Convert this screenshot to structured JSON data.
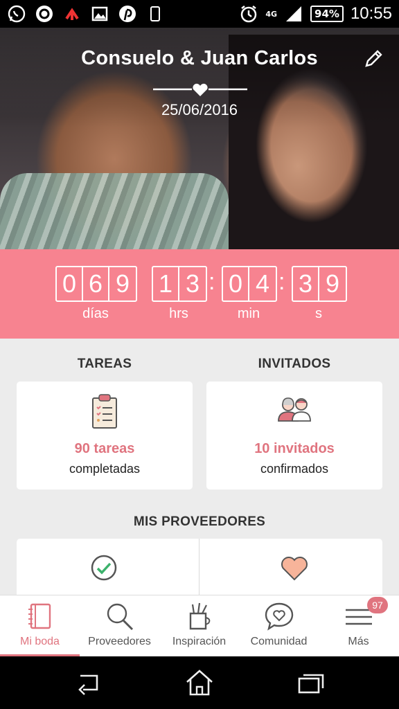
{
  "status_bar": {
    "network": "4G",
    "battery": "94%",
    "time": "10:55",
    "icons": [
      "whatsapp-icon",
      "browser-icon",
      "upload-icon",
      "image-icon",
      "pinterest-icon",
      "phone-icon",
      "alarm-icon",
      "signal-icon"
    ]
  },
  "header": {
    "couple_names": "Consuelo & Juan Carlos",
    "wedding_date": "25/06/2016",
    "edit_icon": "pencil-icon"
  },
  "countdown": {
    "days": [
      "0",
      "6",
      "9"
    ],
    "hours": [
      "1",
      "3"
    ],
    "minutes": [
      "0",
      "4"
    ],
    "seconds": [
      "3",
      "9"
    ],
    "separator": ":",
    "labels": {
      "days": "días",
      "hours": "hrs",
      "minutes": "min",
      "seconds": "s"
    }
  },
  "tasks": {
    "title": "TAREAS",
    "count": "90 tareas",
    "sub": "completadas",
    "icon": "clipboard-icon"
  },
  "guests": {
    "title": "INVITADOS",
    "count": "10 invitados",
    "sub": "confirmados",
    "icon": "guests-icon"
  },
  "vendors": {
    "title": "MIS PROVEEDORES",
    "items": [
      {
        "icon": "check-circle-icon"
      },
      {
        "icon": "heart-icon"
      }
    ]
  },
  "bottom_nav": {
    "items": [
      {
        "label": "Mi boda",
        "icon": "notebook-icon",
        "active": true
      },
      {
        "label": "Proveedores",
        "icon": "search-icon",
        "active": false
      },
      {
        "label": "Inspiración",
        "icon": "pencil-cup-icon",
        "active": false
      },
      {
        "label": "Comunidad",
        "icon": "chat-heart-icon",
        "active": false
      },
      {
        "label": "Más",
        "icon": "menu-icon",
        "active": false
      }
    ],
    "badge": "97"
  },
  "colors": {
    "accent": "#e0747f",
    "countdown_bg": "#f78390",
    "page_bg": "#ececec"
  }
}
